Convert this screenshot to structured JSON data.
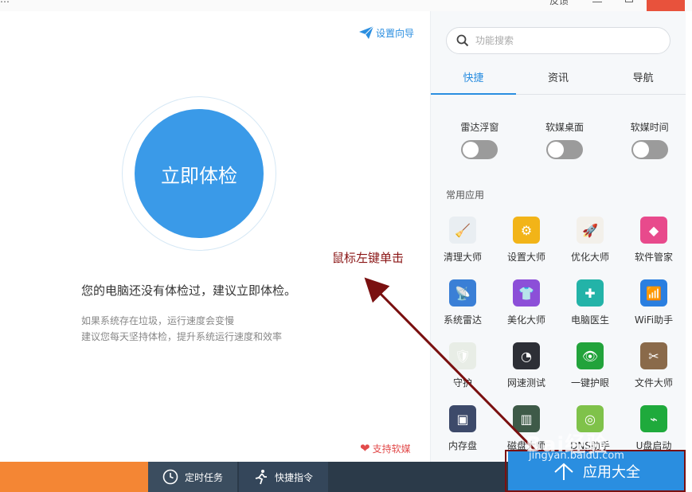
{
  "window": {
    "title_fragment": "…",
    "feedback_label": "反馈"
  },
  "left": {
    "wizard_label": "设置向导",
    "check_button": "立即体检",
    "message": "您的电脑还没有体检过，建议立即体检。",
    "tip1": "如果系统存在垃圾，运行速度会变慢",
    "tip2": "建议您每天坚持体检，提升系统运行速度和效率",
    "support_label": "支持软媒"
  },
  "annotation": "鼠标左键单击",
  "right": {
    "search_placeholder": "功能搜索",
    "tabs": [
      {
        "label": "快捷",
        "active": true
      },
      {
        "label": "资讯",
        "active": false
      },
      {
        "label": "导航",
        "active": false
      }
    ],
    "toggles": [
      {
        "label": "雷达浮窗",
        "on": false
      },
      {
        "label": "软媒桌面",
        "on": false
      },
      {
        "label": "软媒时间",
        "on": false
      }
    ],
    "section_title": "常用应用",
    "apps": [
      {
        "name": "清理大师",
        "icon": "broom-icon",
        "color": "#e9eef2",
        "glyph": "🧹"
      },
      {
        "name": "设置大师",
        "icon": "gear-icon",
        "color": "#f2b418",
        "glyph": "⚙"
      },
      {
        "name": "优化大师",
        "icon": "rocket-icon",
        "color": "#f3f0ea",
        "glyph": "🚀"
      },
      {
        "name": "软件管家",
        "icon": "cube-icon",
        "color": "#e84a8c",
        "glyph": "◆"
      },
      {
        "name": "系统雷达",
        "icon": "radar-icon",
        "color": "#3a7fd6",
        "glyph": "📡"
      },
      {
        "name": "美化大师",
        "icon": "shirt-icon",
        "color": "#8c4fd8",
        "glyph": "👕"
      },
      {
        "name": "电脑医生",
        "icon": "medkit-icon",
        "color": "#23b3a8",
        "glyph": "✚"
      },
      {
        "name": "WiFi助手",
        "icon": "wifi-icon",
        "color": "#2a7fe0",
        "glyph": "📶"
      },
      {
        "name": "守护",
        "icon": "shield-icon",
        "color": "#e8ede6",
        "glyph": "🛡"
      },
      {
        "name": "网速测试",
        "icon": "speedometer-icon",
        "color": "#2d2f36",
        "glyph": "◔"
      },
      {
        "name": "一键护眼",
        "icon": "eye-icon",
        "color": "#22a33b",
        "glyph": "👁"
      },
      {
        "name": "文件大师",
        "icon": "scissors-icon",
        "color": "#8a6a4a",
        "glyph": "✂"
      },
      {
        "name": "内存盘",
        "icon": "chip-icon",
        "color": "#3d4a6a",
        "glyph": "▣"
      },
      {
        "name": "磁盘大师",
        "icon": "disk-icon",
        "color": "#3e5a48",
        "glyph": "▥"
      },
      {
        "name": "DNS助手",
        "icon": "dns-icon",
        "color": "#7fc24a",
        "glyph": "◎"
      },
      {
        "name": "U盘启动",
        "icon": "usb-icon",
        "color": "#1faa3c",
        "glyph": "⌁"
      }
    ]
  },
  "bottom": {
    "timer_label": "定时任务",
    "quick_label": "快捷指令",
    "all_apps_label": "应用大全"
  },
  "watermark": {
    "line1": "Bai经验",
    "line2": "jingyan.baidu.com"
  },
  "colors": {
    "accent": "#2a8ee0",
    "check_button": "#3a9ae8",
    "bottom_bar": "#2b3a49",
    "orange": "#f48634",
    "annotation": "#8a1414"
  }
}
